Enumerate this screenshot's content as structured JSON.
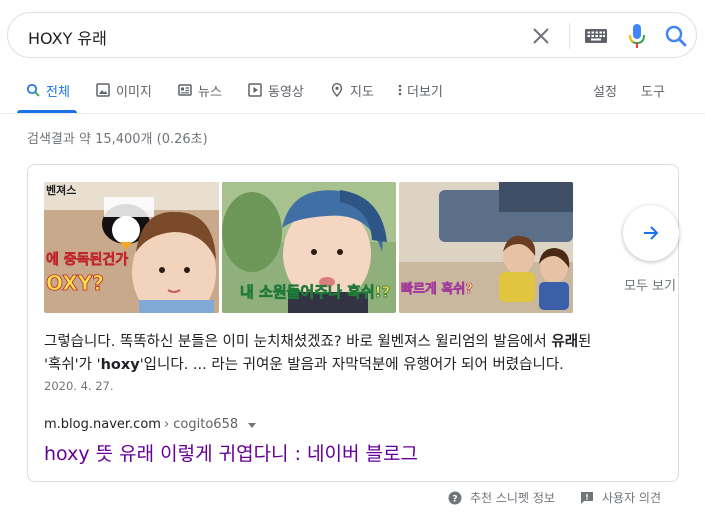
{
  "search": {
    "query": "HOXY 유래"
  },
  "tabs": [
    {
      "label": "전체",
      "icon": "search-icon",
      "active": true
    },
    {
      "label": "이미지",
      "icon": "image-icon"
    },
    {
      "label": "뉴스",
      "icon": "news-icon"
    },
    {
      "label": "동영상",
      "icon": "video-icon"
    },
    {
      "label": "지도",
      "icon": "map-pin-icon"
    },
    {
      "label": "더보기",
      "icon": "more-vert-icon"
    }
  ],
  "tools": {
    "settings": "설정",
    "tools": "도구"
  },
  "stats": "검색결과 약 15,400개 (0.26초)",
  "featured": {
    "images": [
      {
        "caption": "벤져스 / 에 중독된건가 / OXY?"
      },
      {
        "caption": "내 소원들어주나 혹쉬!?"
      },
      {
        "caption": "빠르게 혹쉬?"
      }
    ],
    "more_label": "모두 보기",
    "snippet": {
      "part1": "그렇습니다. 똑똑하신 분들은 이미 눈치채셨겠죠? 바로 윌벤져스 윌리엄의 발음에서 ",
      "bold1": "유래",
      "part2": "된",
      "part3": "'혹쉬'가 '",
      "bold2": "hoxy",
      "part4": "'입니다. ... 라는 귀여운 발음과 자막덕분에 유행어가 되어 버렸습니다."
    },
    "date": "2020. 4. 27.",
    "cite_domain": "m.blog.naver.com",
    "cite_path": " › cogito658",
    "title": "hoxy 뜻 유래 이렇게 귀엽다니 : 네이버 블로그"
  },
  "footer": {
    "about": "추천 스니펫 정보",
    "feedback": "사용자 의견"
  },
  "colors": {
    "accent": "#1a73e8",
    "visited_link": "#660099",
    "meta": "#70757a"
  }
}
